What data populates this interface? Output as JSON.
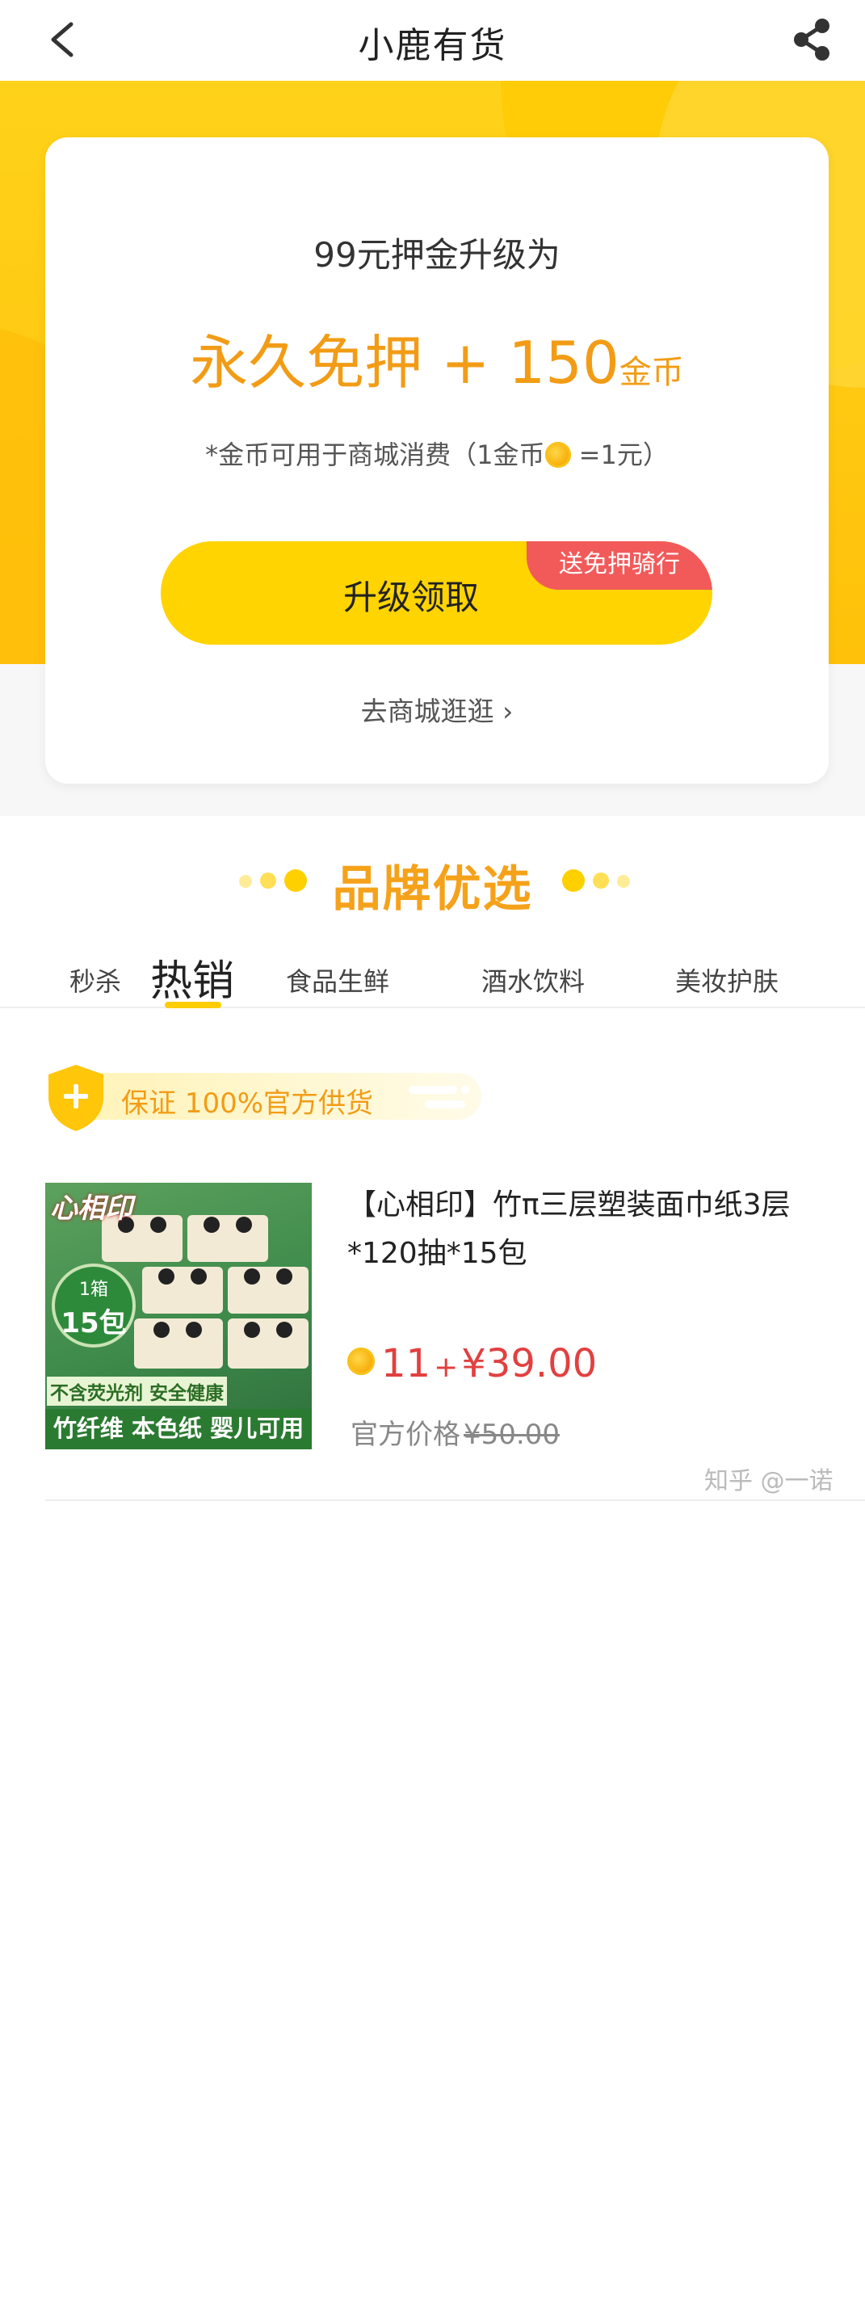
{
  "nav": {
    "title": "小鹿有货",
    "back_icon": "chevron-left-icon",
    "share_icon": "share-icon"
  },
  "upgrade_card": {
    "line1": "99元押金升级为",
    "headline_main": "永久免押 + 150",
    "headline_unit": "金币",
    "note_prefix": "*金币可用于商城消费（1金币",
    "note_suffix": " =1元）",
    "button_label": "升级领取",
    "button_tag": "送免押骑行",
    "mall_link": "去商城逛逛 ›"
  },
  "brand": {
    "title": "品牌优选",
    "tabs": [
      {
        "label": "秒杀",
        "active": false
      },
      {
        "label": "热销",
        "active": true
      },
      {
        "label": "食品生鲜",
        "active": false
      },
      {
        "label": "酒水饮料",
        "active": false
      },
      {
        "label": "美妆护肤",
        "active": false
      }
    ],
    "guarantee": "保证 100%官方供货"
  },
  "product": {
    "title": "【心相印】竹π三层塑装面巾纸3层*120抽*15包",
    "image": {
      "logo": "心相印",
      "badge_top": "1箱",
      "badge_bottom": "15包",
      "caption1": "不含荧光剂 安全健康",
      "caption2": "竹纤维 本色纸 婴儿可用"
    },
    "coins": "11",
    "plus": "+",
    "price": "¥39.00",
    "official_label": "官方价格",
    "official_price": "¥50.00"
  },
  "watermark": "知乎 @一诺",
  "colors": {
    "accent_yellow": "#ffd400",
    "accent_orange": "#f29c16",
    "tag_red": "#f25a5a",
    "price_red": "#e24040"
  }
}
